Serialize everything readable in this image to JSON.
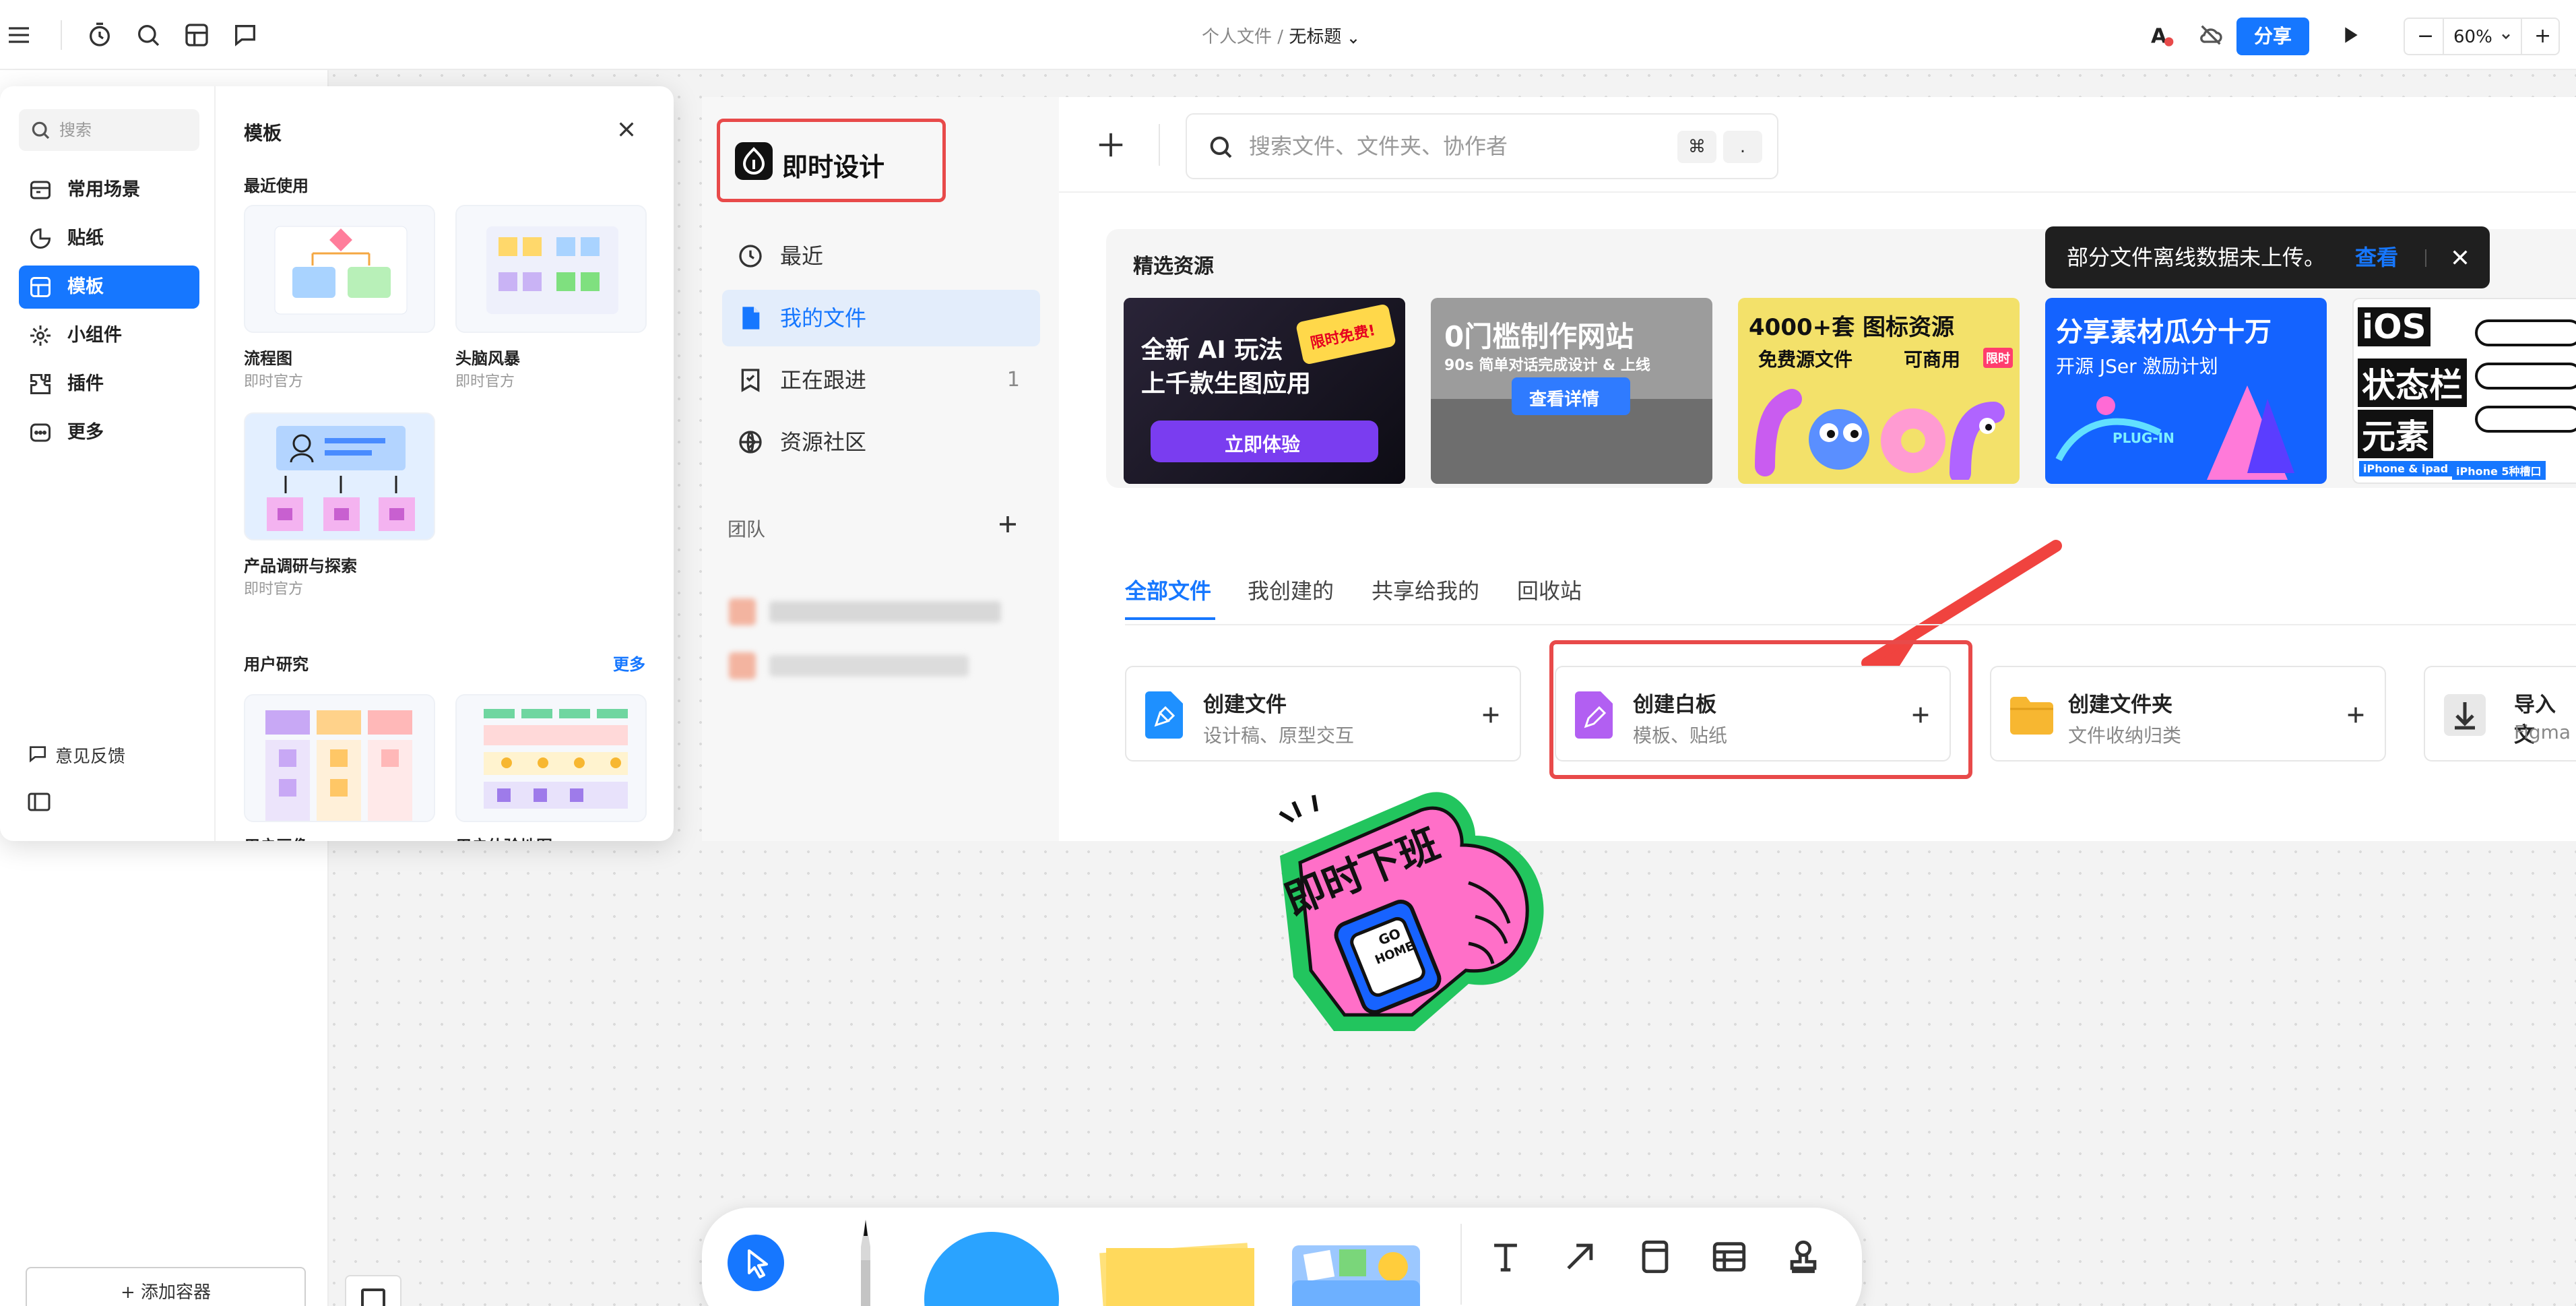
{
  "topbar": {
    "breadcrumb_parent": "个人文件",
    "breadcrumb_sep": "/",
    "breadcrumb_current": "无标题",
    "share_label": "分享",
    "zoom_value": "60%",
    "zoom_minus": "−",
    "zoom_plus": "+",
    "icons": [
      "menu-icon",
      "timer-icon",
      "search-icon",
      "template-icon",
      "comment-icon",
      "font-alert-icon",
      "cloud-off-icon",
      "play-icon"
    ]
  },
  "template_panel": {
    "search_placeholder": "搜索",
    "title": "模板",
    "nav": [
      {
        "label": "常用场景",
        "icon": "scene-icon"
      },
      {
        "label": "贴纸",
        "icon": "sticker-icon"
      },
      {
        "label": "模板",
        "icon": "template-icon",
        "active": true
      },
      {
        "label": "小组件",
        "icon": "widget-icon"
      },
      {
        "label": "插件",
        "icon": "plugin-icon"
      },
      {
        "label": "更多",
        "icon": "more-icon"
      }
    ],
    "feedback_label": "意见反馈",
    "recent_section": "最近使用",
    "cards": [
      {
        "name": "流程图",
        "author": "即时官方"
      },
      {
        "name": "头脑风暴",
        "author": "即时官方"
      },
      {
        "name": "产品调研与探索",
        "author": "即时官方"
      }
    ],
    "user_research_section": "用户研究",
    "more_link": "更多",
    "research_cards": [
      {
        "name": "用户画像"
      },
      {
        "name": "用户体验地图"
      }
    ]
  },
  "file_manager": {
    "brand": "即时设计",
    "nav": [
      {
        "label": "最近",
        "icon": "clock-icon"
      },
      {
        "label": "我的文件",
        "icon": "file-icon",
        "active": true
      },
      {
        "label": "正在跟进",
        "icon": "follow-icon",
        "count": "1"
      },
      {
        "label": "资源社区",
        "icon": "globe-icon"
      }
    ],
    "team_label": "团队",
    "search_placeholder": "搜索文件、文件夹、协作者",
    "shortcut_cmd": "⌘",
    "shortcut_dot": ".",
    "featured_title": "精选资源",
    "banners": [
      {
        "line1": "全新 AI 玩法",
        "line2": "上千款生图应用",
        "badge": "限时免费!",
        "button": "立即体验",
        "bg": "#1a1a2e"
      },
      {
        "line1": "0门槛制作网站",
        "line2": "90s 简单对话完成设计 & 上线",
        "button": "查看详情",
        "bg": "#8d8d8d"
      },
      {
        "line1": "4000+套 图标资源",
        "line2": "免费源文件",
        "line3": "可商用",
        "badge": "限时",
        "bg": "#f7e36a"
      },
      {
        "line1": "分享素材瓜分十万",
        "line2": "开源 JSer 激励计划",
        "badge": "PLUG-IN",
        "bg": "#1a5bff"
      },
      {
        "line1": "iOS",
        "line2": "状态栏",
        "line3": "元素",
        "tag1": "iPhone & ipad",
        "tag2": "iPhone 5种槽口",
        "bg": "#ffffff"
      }
    ],
    "toast": {
      "message": "部分文件离线数据未上传。",
      "action": "查看"
    },
    "tabs": [
      "全部文件",
      "我创建的",
      "共享给我的",
      "回收站"
    ],
    "actions": [
      {
        "name": "创建文件",
        "sub": "设计稿、原型交互",
        "color": "#1677ff"
      },
      {
        "name": "创建白板",
        "sub": "模板、贴纸",
        "color": "#a65cf0"
      },
      {
        "name": "创建文件夹",
        "sub": "文件收纳归类",
        "color": "#f7b731"
      },
      {
        "name": "导入文",
        "sub": "Figma",
        "color": "#444444"
      }
    ]
  },
  "sticker": {
    "text": "即时下班",
    "watch_text1": "GO",
    "watch_text2": "HOME"
  },
  "sidebar": {
    "add_container_label": "添加容器"
  },
  "toolbar": {
    "tools": [
      "pointer-icon",
      "pen-icon",
      "circle-shape",
      "sticky-note",
      "sticker-folder",
      "text-icon",
      "arrow-icon",
      "frame-icon",
      "table-icon",
      "stamp-icon"
    ]
  },
  "colors": {
    "accent": "#1677ff",
    "highlight_red": "#e84a4a"
  }
}
